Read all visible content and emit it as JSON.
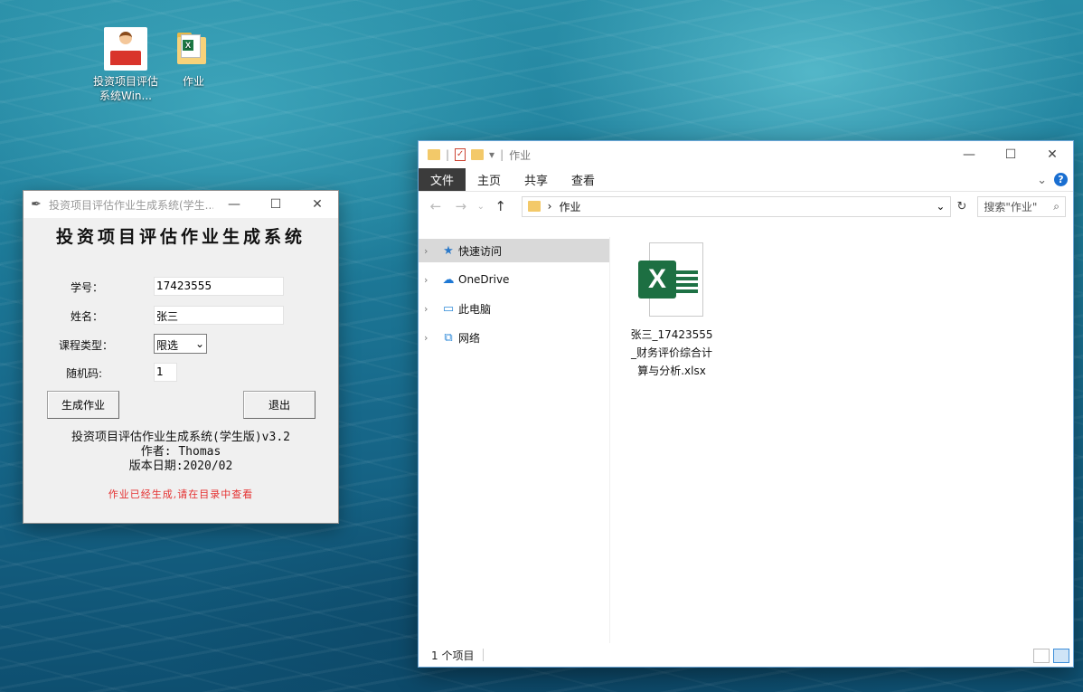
{
  "desktop": {
    "icons": [
      {
        "label": "投资项目评估系统Win...",
        "icon": "app-icon"
      },
      {
        "label": "作业",
        "icon": "excel-folder-icon"
      }
    ]
  },
  "app": {
    "window_title": "投资项目评估作业生成系统(学生...",
    "heading": "投资项目评估作业生成系统",
    "labels": {
      "student_id": "学号：",
      "name": "姓名：",
      "course_type": "课程类型：",
      "random_code": "随机码:"
    },
    "fields": {
      "student_id": "17423555",
      "name": "张三",
      "course_type": "限选",
      "random_code": "1"
    },
    "buttons": {
      "generate": "生成作业",
      "exit": "退出"
    },
    "info": {
      "line1": "投资项目评估作业生成系统(学生版)v3.2",
      "line2": "作者: Thomas",
      "line3": "版本日期:2020/02"
    },
    "message": "作业已经生成,请在目录中查看"
  },
  "explorer": {
    "window_title": "作业",
    "ribbon": [
      "文件",
      "主页",
      "共享",
      "查看"
    ],
    "address": "作业",
    "search_placeholder": "搜索\"作业\"",
    "nav": [
      {
        "label": "快速访问",
        "icon": "star-icon"
      },
      {
        "label": "OneDrive",
        "icon": "cloud-icon"
      },
      {
        "label": "此电脑",
        "icon": "computer-icon"
      },
      {
        "label": "网络",
        "icon": "network-icon"
      }
    ],
    "files": [
      {
        "name": "张三_17423555_财务评价综合计算与分析.xlsx",
        "icon": "excel-file-icon"
      }
    ],
    "status": "1 个项目"
  },
  "colors": {
    "message": "#e53030",
    "excel_green": "#1d6f42",
    "accent": "#1a6fd1"
  }
}
